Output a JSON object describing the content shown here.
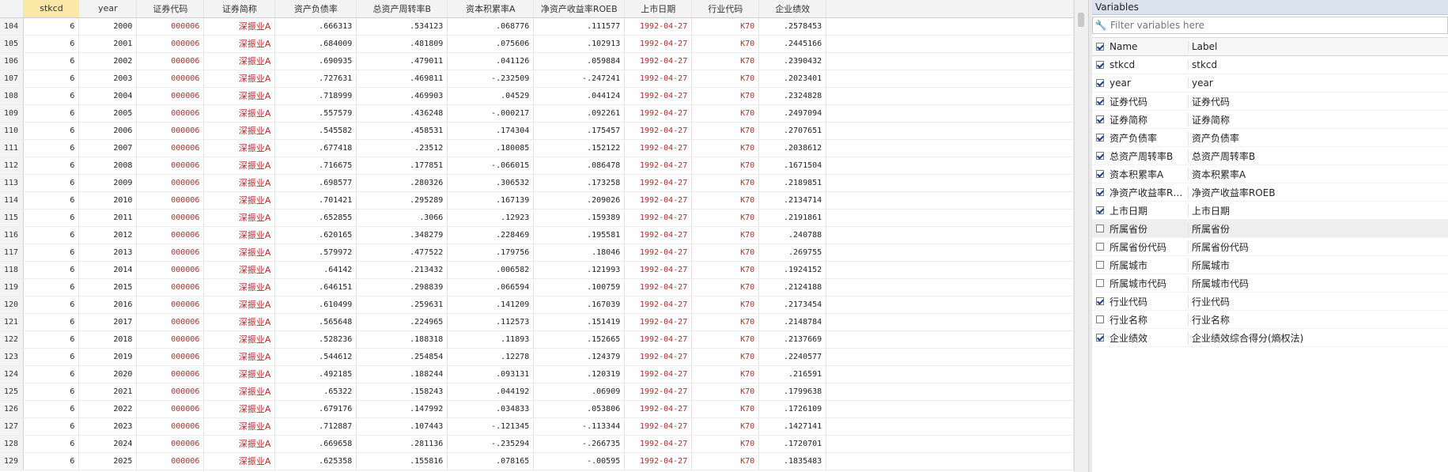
{
  "grid": {
    "columns": [
      "stkcd",
      "year",
      "证券代码",
      "证券简称",
      "资产负债率",
      "总资产周转率B",
      "资本积累率A",
      "净资产收益率ROEB",
      "上市日期",
      "行业代码",
      "企业绩效"
    ],
    "rows": [
      [
        "104",
        "6",
        "2000",
        "000006",
        "深振业A",
        ".666313",
        ".534123",
        ".068776",
        ".111577",
        "1992-04-27",
        "K70",
        ".2578453"
      ],
      [
        "105",
        "6",
        "2001",
        "000006",
        "深振业A",
        ".684009",
        ".481809",
        ".075606",
        ".102913",
        "1992-04-27",
        "K70",
        ".2445166"
      ],
      [
        "106",
        "6",
        "2002",
        "000006",
        "深振业A",
        ".690935",
        ".479011",
        ".041126",
        ".059884",
        "1992-04-27",
        "K70",
        ".2390432"
      ],
      [
        "107",
        "6",
        "2003",
        "000006",
        "深振业A",
        ".727631",
        ".469811",
        "-.232509",
        "-.247241",
        "1992-04-27",
        "K70",
        ".2023401"
      ],
      [
        "108",
        "6",
        "2004",
        "000006",
        "深振业A",
        ".718999",
        ".469903",
        ".04529",
        ".044124",
        "1992-04-27",
        "K70",
        ".2324828"
      ],
      [
        "109",
        "6",
        "2005",
        "000006",
        "深振业A",
        ".557579",
        ".436248",
        "-.000217",
        ".092261",
        "1992-04-27",
        "K70",
        ".2497094"
      ],
      [
        "110",
        "6",
        "2006",
        "000006",
        "深振业A",
        ".545582",
        ".458531",
        ".174304",
        ".175457",
        "1992-04-27",
        "K70",
        ".2707651"
      ],
      [
        "111",
        "6",
        "2007",
        "000006",
        "深振业A",
        ".677418",
        ".23512",
        ".180085",
        ".152122",
        "1992-04-27",
        "K70",
        ".2038612"
      ],
      [
        "112",
        "6",
        "2008",
        "000006",
        "深振业A",
        ".716675",
        ".177851",
        "-.066015",
        ".086478",
        "1992-04-27",
        "K70",
        ".1671504"
      ],
      [
        "113",
        "6",
        "2009",
        "000006",
        "深振业A",
        ".698577",
        ".280326",
        ".306532",
        ".173258",
        "1992-04-27",
        "K70",
        ".2189851"
      ],
      [
        "114",
        "6",
        "2010",
        "000006",
        "深振业A",
        ".701421",
        ".295289",
        ".167139",
        ".209026",
        "1992-04-27",
        "K70",
        ".2134714"
      ],
      [
        "115",
        "6",
        "2011",
        "000006",
        "深振业A",
        ".652855",
        ".3066",
        ".12923",
        ".159389",
        "1992-04-27",
        "K70",
        ".2191861"
      ],
      [
        "116",
        "6",
        "2012",
        "000006",
        "深振业A",
        ".620165",
        ".348279",
        ".228469",
        ".195581",
        "1992-04-27",
        "K70",
        ".240788"
      ],
      [
        "117",
        "6",
        "2013",
        "000006",
        "深振业A",
        ".579972",
        ".477522",
        ".179756",
        ".18046",
        "1992-04-27",
        "K70",
        ".269755"
      ],
      [
        "118",
        "6",
        "2014",
        "000006",
        "深振业A",
        ".64142",
        ".213432",
        ".006582",
        ".121993",
        "1992-04-27",
        "K70",
        ".1924152"
      ],
      [
        "119",
        "6",
        "2015",
        "000006",
        "深振业A",
        ".646151",
        ".298839",
        ".066594",
        ".100759",
        "1992-04-27",
        "K70",
        ".2124188"
      ],
      [
        "120",
        "6",
        "2016",
        "000006",
        "深振业A",
        ".610499",
        ".259631",
        ".141209",
        ".167039",
        "1992-04-27",
        "K70",
        ".2173454"
      ],
      [
        "121",
        "6",
        "2017",
        "000006",
        "深振业A",
        ".565648",
        ".224965",
        ".112573",
        ".151419",
        "1992-04-27",
        "K70",
        ".2148784"
      ],
      [
        "122",
        "6",
        "2018",
        "000006",
        "深振业A",
        ".528236",
        ".188318",
        ".11893",
        ".152665",
        "1992-04-27",
        "K70",
        ".2137669"
      ],
      [
        "123",
        "6",
        "2019",
        "000006",
        "深振业A",
        ".544612",
        ".254854",
        ".12278",
        ".124379",
        "1992-04-27",
        "K70",
        ".2240577"
      ],
      [
        "124",
        "6",
        "2020",
        "000006",
        "深振业A",
        ".492185",
        ".188244",
        ".093131",
        ".120319",
        "1992-04-27",
        "K70",
        ".216591"
      ],
      [
        "125",
        "6",
        "2021",
        "000006",
        "深振业A",
        ".65322",
        ".158243",
        ".044192",
        ".06909",
        "1992-04-27",
        "K70",
        ".1799638"
      ],
      [
        "126",
        "6",
        "2022",
        "000006",
        "深振业A",
        ".679176",
        ".147992",
        ".034833",
        ".053806",
        "1992-04-27",
        "K70",
        ".1726109"
      ],
      [
        "127",
        "6",
        "2023",
        "000006",
        "深振业A",
        ".712887",
        ".107443",
        "-.121345",
        "-.113344",
        "1992-04-27",
        "K70",
        ".1427141"
      ],
      [
        "128",
        "6",
        "2024",
        "000006",
        "深振业A",
        ".669658",
        ".281136",
        "-.235294",
        "-.266735",
        "1992-04-27",
        "K70",
        ".1720701"
      ],
      [
        "129",
        "6",
        "2025",
        "000006",
        "深振业A",
        ".625358",
        ".155816",
        ".078165",
        "-.00595",
        "1992-04-27",
        "K70",
        ".1835483"
      ]
    ]
  },
  "variables": {
    "title": "Variables",
    "filter_placeholder": "Filter variables here",
    "header_name": "Name",
    "header_label": "Label",
    "items": [
      {
        "name": "stkcd",
        "label": "stkcd",
        "checked": true
      },
      {
        "name": "year",
        "label": "year",
        "checked": true
      },
      {
        "name": "证券代码",
        "label": "证券代码",
        "checked": true
      },
      {
        "name": "证券简称",
        "label": "证券简称",
        "checked": true
      },
      {
        "name": "资产负债率",
        "label": "资产负债率",
        "checked": true
      },
      {
        "name": "总资产周转率B",
        "label": "总资产周转率B",
        "checked": true
      },
      {
        "name": "资本积累率A",
        "label": "资本积累率A",
        "checked": true
      },
      {
        "name": "净资产收益率RO...",
        "label": "净资产收益率ROEB",
        "checked": true
      },
      {
        "name": "上市日期",
        "label": "上市日期",
        "checked": true
      },
      {
        "name": "所属省份",
        "label": "所属省份",
        "checked": false
      },
      {
        "name": "所属省份代码",
        "label": "所属省份代码",
        "checked": false
      },
      {
        "name": "所属城市",
        "label": "所属城市",
        "checked": false
      },
      {
        "name": "所属城市代码",
        "label": "所属城市代码",
        "checked": false
      },
      {
        "name": "行业代码",
        "label": "行业代码",
        "checked": true
      },
      {
        "name": "行业名称",
        "label": "行业名称",
        "checked": false
      },
      {
        "name": "企业绩效",
        "label": "企业绩效综合得分(熵权法)",
        "checked": true
      }
    ]
  },
  "colors": {
    "string_value": "#b8282a",
    "selected_header": "#fbe7a6",
    "panel_title": "#dbe3ee"
  },
  "icons": {
    "filter": "wrench-icon",
    "checkbox": "checkbox-icon"
  }
}
